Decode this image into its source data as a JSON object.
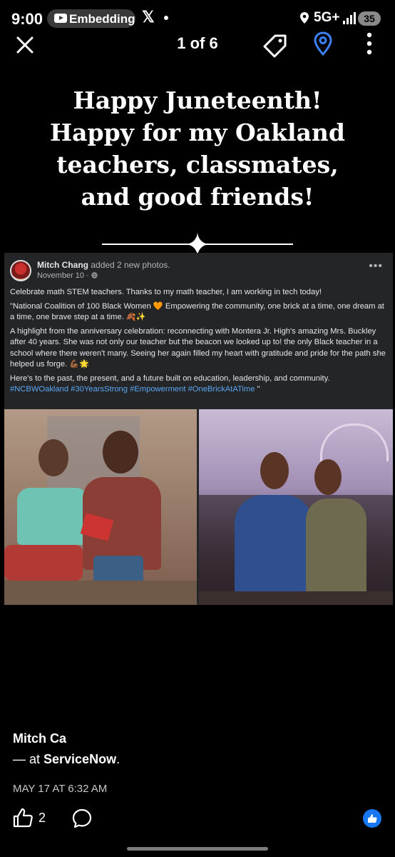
{
  "status_bar": {
    "time": "9:00",
    "notification_pill": "Embedding",
    "x_logo": "𝕏",
    "network": "5G+",
    "battery": "35"
  },
  "viewer": {
    "counter": "1 of 6"
  },
  "headline": {
    "line1": "Happy Juneteenth!",
    "line2": "Happy for my Oakland",
    "line3": "teachers, classmates,",
    "line4": "and good friends!"
  },
  "embedded_post": {
    "author_name": "Mitch Chang",
    "action_text": "added 2 new photos.",
    "date": "November 10 · ",
    "more": "•••",
    "paragraph1": "Celebrate math STEM teachers. Thanks to my math teacher, I am working in tech today!",
    "paragraph2": "\"National Coalition of 100 Black Women 🧡 Empowering the community, one brick at a time, one dream at a time, one brave step at a time. 🍂✨",
    "paragraph3": "A highlight from the anniversary celebration: reconnecting with Montera Jr. High's amazing Mrs. Buckley after 40 years. She was not only our teacher but the beacon we looked up to! the only Black teacher in a school where there weren't many. Seeing her again filled my heart with gratitude and pride for the path she helped us forge. 💪🏾🌟",
    "paragraph4": "Here's to the past, the present, and a future built on education, leadership, and community.",
    "hashtags": "#NCBWOakland #30YearsStrong #Empowerment #OneBrickAtATime",
    "hashtags_tail": " \""
  },
  "footer": {
    "author": "Mitch Ca",
    "at_prefix": "— at ",
    "place": "ServiceNow",
    "period": ".",
    "timestamp": "MAY 17 AT 6:32 AM",
    "like_count": "2"
  },
  "colors": {
    "background": "#000000",
    "link": "#5aa7f5",
    "pin_accent": "#3b82f6",
    "like_badge": "#1877f2"
  }
}
